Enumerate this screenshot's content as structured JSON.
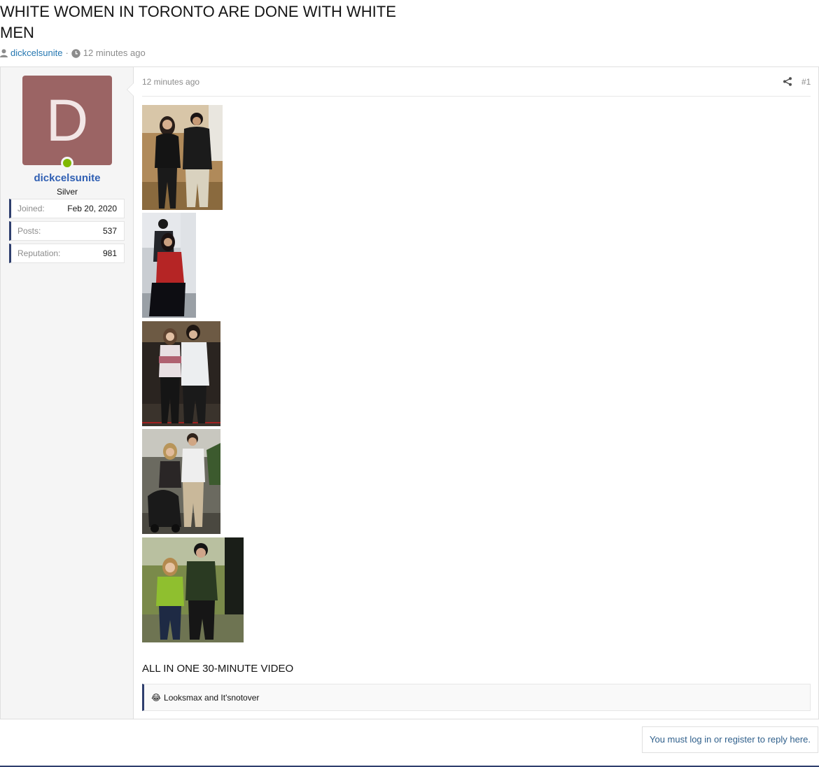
{
  "thread": {
    "title": "WHITE WOMEN IN TORONTO ARE DONE WITH WHITE MEN",
    "author": "dickcelsunite",
    "time": "12 minutes ago"
  },
  "user": {
    "avatar_letter": "D",
    "avatar_color": "#9b6464",
    "online_color": "#7fb900",
    "name": "dickcelsunite",
    "title": "Silver",
    "stats": [
      {
        "label": "Joined:",
        "value": "Feb 20, 2020"
      },
      {
        "label": "Posts:",
        "value": "537"
      },
      {
        "label": "Reputation:",
        "value": "981"
      }
    ]
  },
  "post": {
    "time": "12 minutes ago",
    "number": "#1",
    "caption": "ALL IN ONE 30-MINUTE VIDEO",
    "reactions_emoji": "😂",
    "reactions_text": "Looksmax and It'snotover"
  },
  "reply": {
    "text": "You must log in or register to reply here."
  },
  "icons": {
    "user": "user-icon",
    "clock": "clock-icon",
    "share": "share-icon"
  }
}
